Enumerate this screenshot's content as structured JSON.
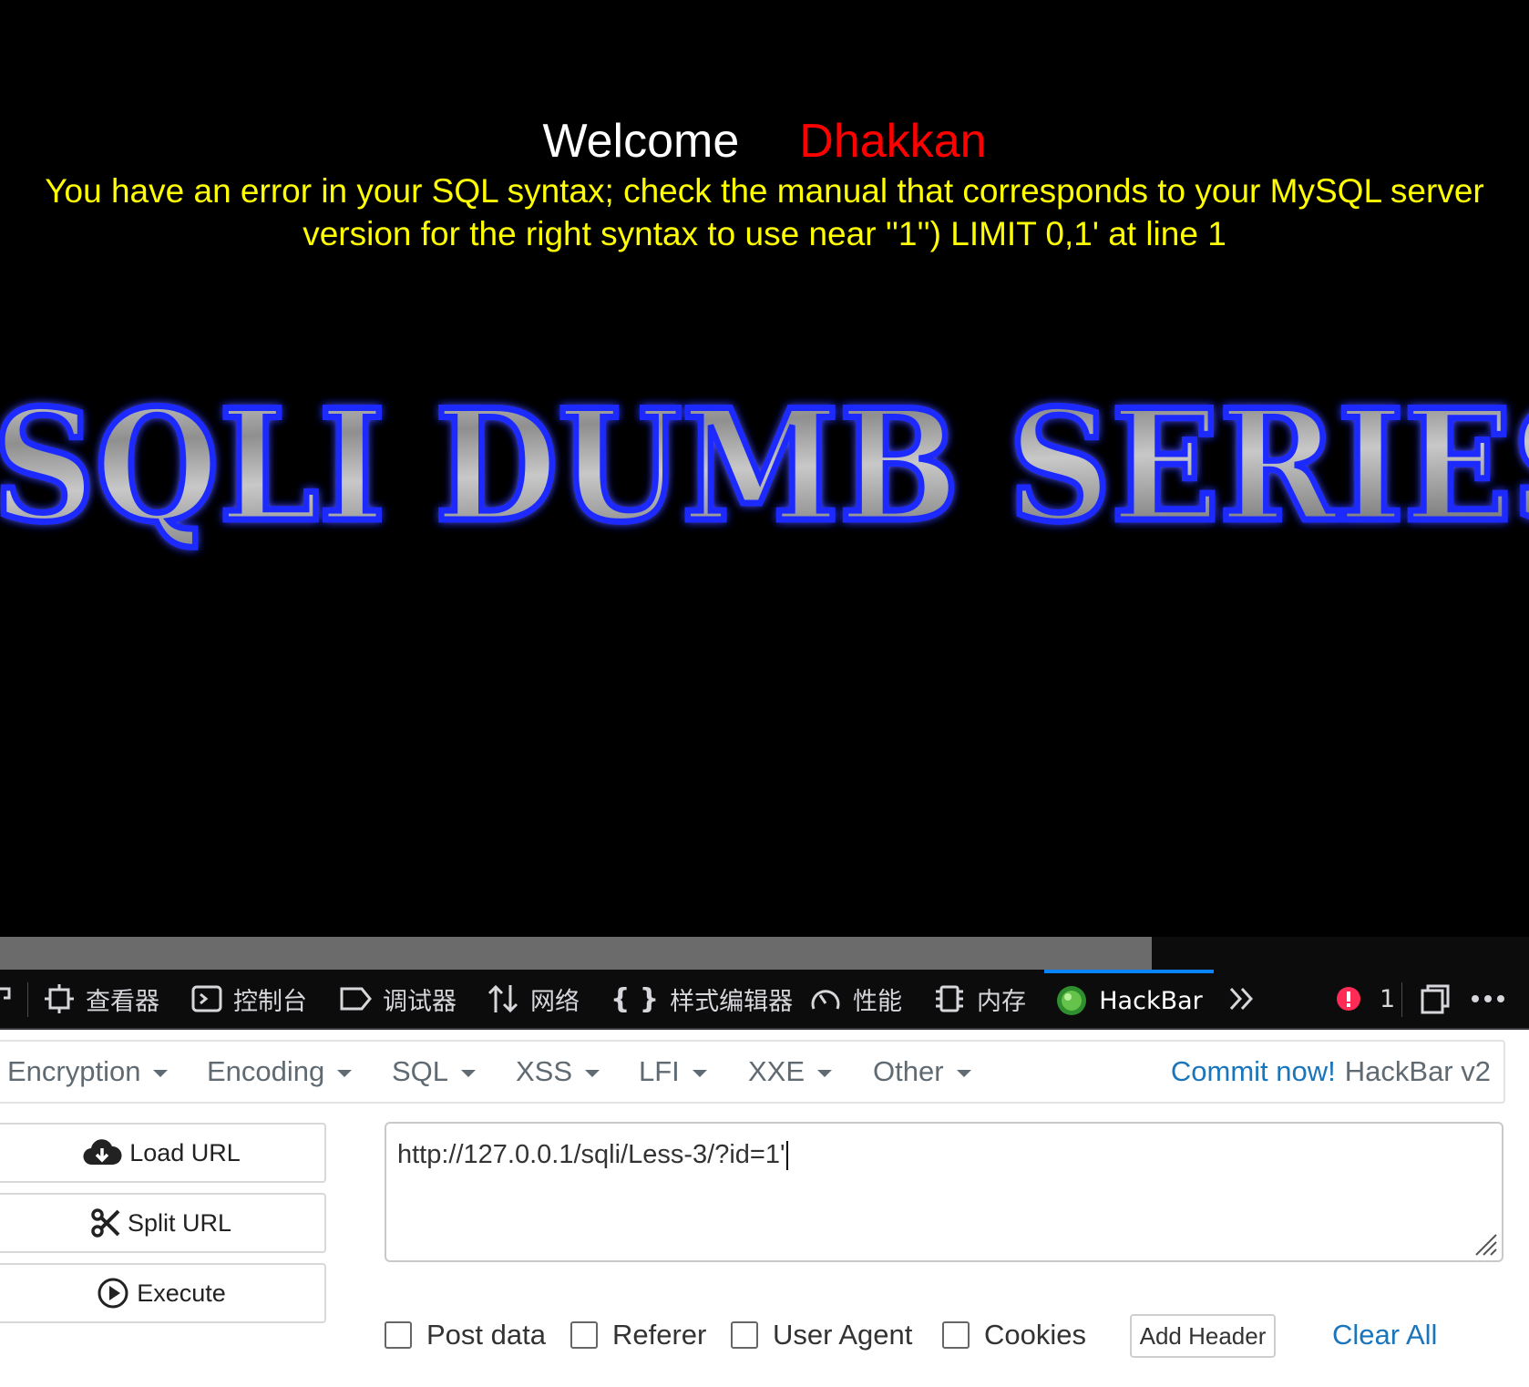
{
  "page": {
    "welcome_label": "Welcome",
    "user_name": "Dhakkan",
    "error_message": "You have an error in your SQL syntax; check the manual that corresponds to your MySQL server version for the right syntax to use near ''1'') LIMIT 0,1' at line 1",
    "banner_text": "SQLI DUMB SERIES"
  },
  "colors": {
    "background": "#000000",
    "welcome": "#ffffff",
    "user_name": "#ff0000",
    "error": "#ffff00",
    "active_tab": "#0a84ff",
    "link_blue": "#1a75bb"
  },
  "devtools": {
    "tabs": [
      {
        "label": "查看器",
        "icon": "inspector-icon"
      },
      {
        "label": "控制台",
        "icon": "console-icon"
      },
      {
        "label": "调试器",
        "icon": "debugger-icon"
      },
      {
        "label": "网络",
        "icon": "network-icon"
      },
      {
        "label": "样式编辑器",
        "icon": "style-editor-icon"
      },
      {
        "label": "性能",
        "icon": "performance-icon"
      },
      {
        "label": "内存",
        "icon": "memory-icon"
      },
      {
        "label": "HackBar",
        "icon": "hackbar-icon",
        "active": true
      }
    ],
    "error_count": "1"
  },
  "hackbar": {
    "menus": [
      "Encryption",
      "Encoding",
      "SQL",
      "XSS",
      "LFI",
      "XXE",
      "Other"
    ],
    "commit_link": "Commit now!",
    "version": "HackBar v2",
    "buttons": {
      "load_url": "Load URL",
      "split_url": "Split URL",
      "execute": "Execute"
    },
    "url_value": "http://127.0.0.1/sqli/Less-3/?id=1'",
    "options": [
      "Post data",
      "Referer",
      "User Agent",
      "Cookies"
    ],
    "add_header": "Add Header",
    "clear_all": "Clear All"
  }
}
